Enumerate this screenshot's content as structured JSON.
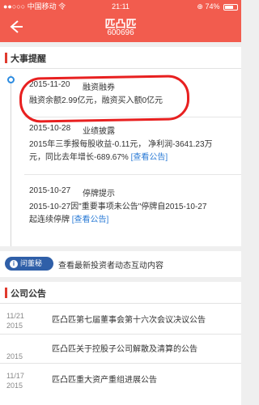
{
  "status": {
    "carrier": "●●○○○ 中国移动 令",
    "time": "21:11",
    "battery": "⊕ 74%",
    "battery_level": 0.74
  },
  "nav": {
    "title": "匹凸匹",
    "code": "600696"
  },
  "events_section": {
    "title": "大事提醒"
  },
  "events": [
    {
      "date": "2015-11-20",
      "type": "融资融券",
      "line1": "融资余额2.99亿元，融资买入额0亿元",
      "line2": "",
      "line3": "",
      "link": ""
    },
    {
      "date": "2015-10-28",
      "type": "业绩披露",
      "line1": "2015年三季报每股收益-0.11元，  净利润-3641.23万",
      "line2": "元，同比去年增长-689.67%",
      "line3": "",
      "link": "[查看公告]"
    },
    {
      "date": "2015-10-27",
      "type": "停牌提示",
      "line1": "2015-10-27因\"重要事项未公告\"停牌自2015-10-27",
      "line2": "起连续停牌",
      "line3": "",
      "link": "[查看公告]"
    }
  ],
  "qa": {
    "badge_icon": "i",
    "badge": "问董秘",
    "text": "查看最新投资者动态互动内容"
  },
  "announcements_section": {
    "title": "公司公告"
  },
  "announcements": [
    {
      "date_md": "11/21",
      "year": "2015",
      "title": "匹凸匹第七届董事会第十六次会议决议公告"
    },
    {
      "date_md": "",
      "year": "2015",
      "title": "匹凸匹关于控股子公司解散及清算的公告"
    },
    {
      "date_md": "11/17",
      "year": "2015",
      "title": "匹凸匹重大资产重组进展公告"
    }
  ]
}
